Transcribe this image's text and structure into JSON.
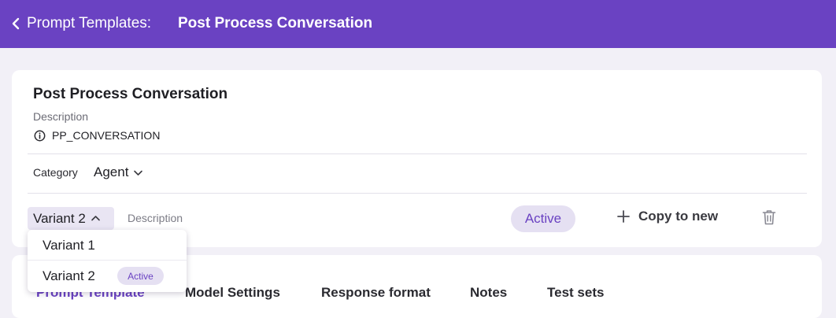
{
  "header": {
    "back_icon": "chevron-left-icon",
    "parent": "Prompt Templates:",
    "current": "Post Process Conversation"
  },
  "template": {
    "title": "Post Process Conversation",
    "description_label": "Description",
    "info_icon": "info-circle-icon",
    "key": "PP_CONVERSATION"
  },
  "category": {
    "label": "Category",
    "value": "Agent",
    "icon": "chevron-down-icon"
  },
  "variant": {
    "selected": "Variant 2",
    "icon": "chevron-up-icon",
    "description_placeholder": "Description",
    "status": "Active",
    "copy_icon": "plus-icon",
    "copy_label": "Copy to new",
    "delete_icon": "trash-icon"
  },
  "variant_options": [
    {
      "label": "Variant 1",
      "badge": ""
    },
    {
      "label": "Variant 2",
      "badge": "Active"
    }
  ],
  "tabs": [
    "Prompt Template",
    "Model Settings",
    "Response format",
    "Notes",
    "Test sets"
  ],
  "active_tab": "Prompt Template",
  "colors": {
    "brand": "#6a42c2",
    "badge_bg": "#e5e0f2",
    "page_bg": "#f2f0f7"
  }
}
